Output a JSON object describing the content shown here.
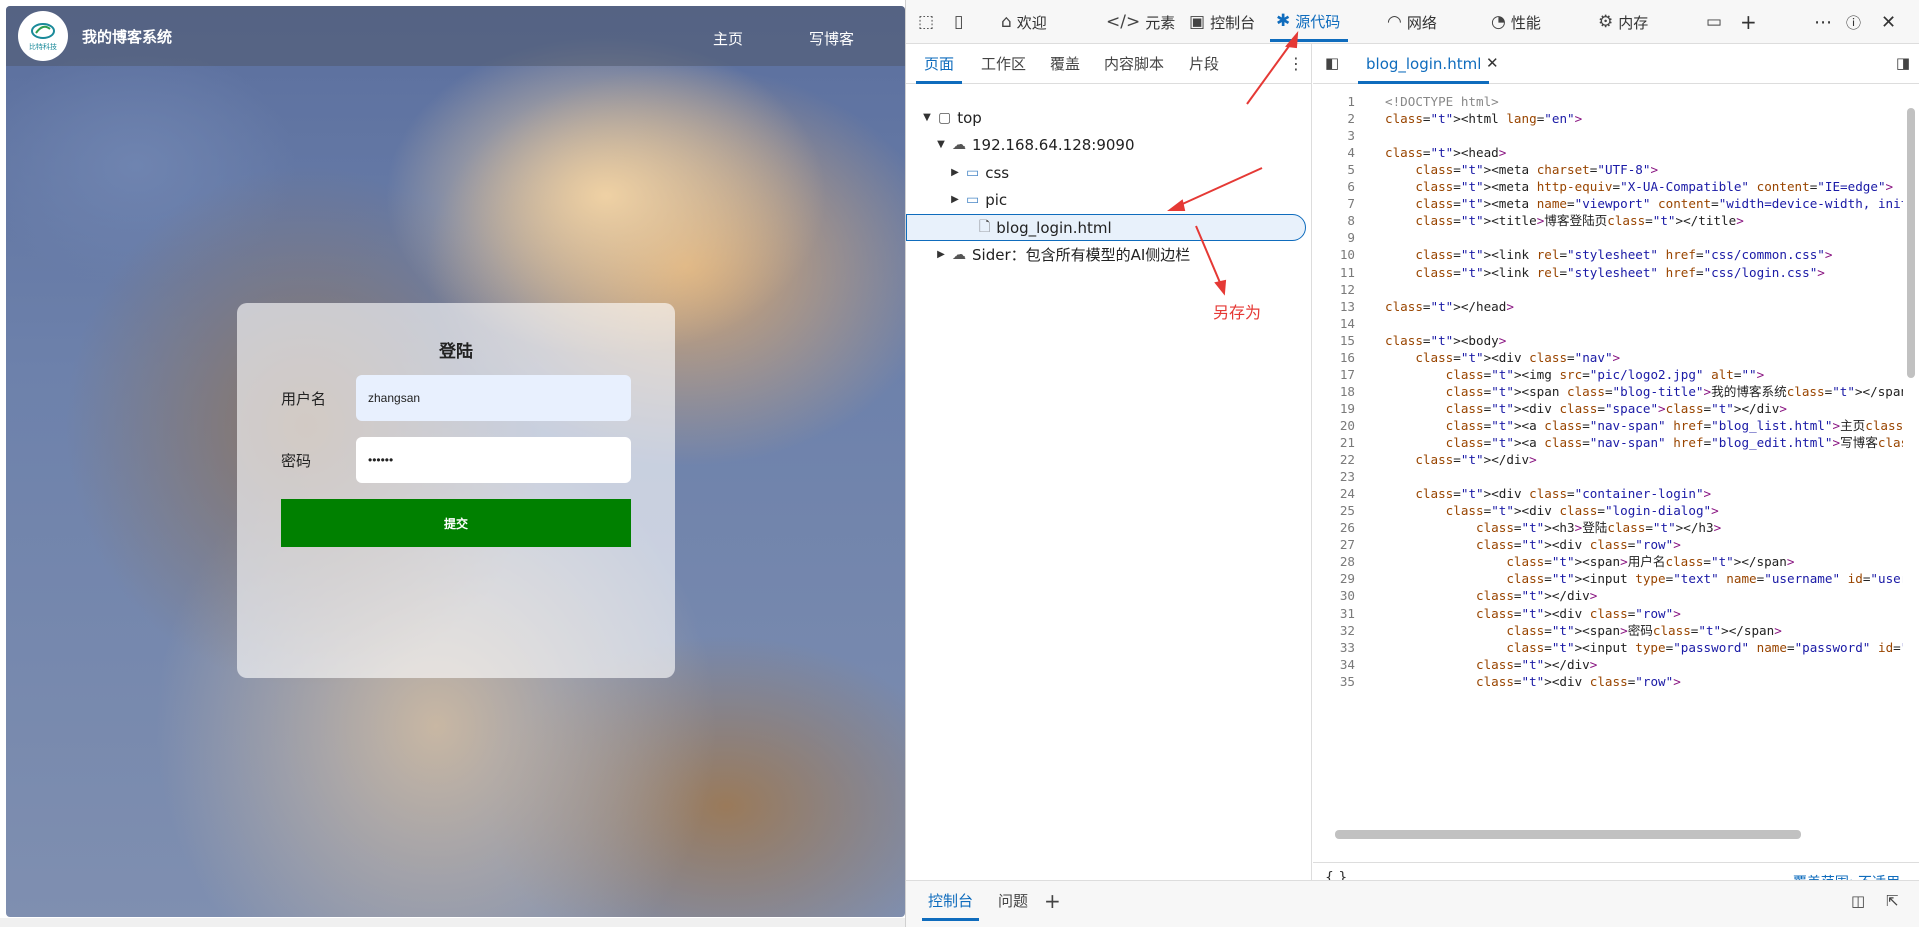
{
  "page": {
    "logo_text": "比特科技",
    "blog_title": "我的博客系统",
    "nav_links": [
      "主页",
      "写博客"
    ],
    "login": {
      "heading": "登陆",
      "username_label": "用户名",
      "username_value": "zhangsan",
      "password_label": "密码",
      "password_value": "••••••",
      "submit_label": "提交"
    }
  },
  "devtools": {
    "tabs": [
      "欢迎",
      "元素",
      "控制台",
      "源代码",
      "网络",
      "性能",
      "内存"
    ],
    "active_tab": "源代码",
    "navigator_tabs": [
      "页面",
      "工作区",
      "覆盖",
      "内容脚本",
      "片段"
    ],
    "tree": {
      "top": "top",
      "host": "192.168.64.128:9090",
      "folder_css": "css",
      "folder_pic": "pic",
      "file": "blog_login.html",
      "extension": "Sider：包含所有模型的AI侧边栏"
    },
    "editor_file": "blog_login.html",
    "status_braces": "{ }",
    "coverage": "覆盖范围: 不适用",
    "drawer_tabs": [
      "控制台",
      "问题"
    ],
    "annotation": "另存为",
    "accent_color": "#0f6cbd",
    "arrow_color": "#e53935"
  },
  "code_lines": [
    [
      "1",
      "<!DOCTYPE html>"
    ],
    [
      "2",
      "<html lang=\"en\">"
    ],
    [
      "3",
      ""
    ],
    [
      "4",
      "<head>"
    ],
    [
      "5",
      "    <meta charset=\"UTF-8\">"
    ],
    [
      "6",
      "    <meta http-equiv=\"X-UA-Compatible\" content=\"IE=edge\">"
    ],
    [
      "7",
      "    <meta name=\"viewport\" content=\"width=device-width, initial"
    ],
    [
      "8",
      "    <title>博客登陆页</title>"
    ],
    [
      "9",
      ""
    ],
    [
      "10",
      "    <link rel=\"stylesheet\" href=\"css/common.css\">"
    ],
    [
      "11",
      "    <link rel=\"stylesheet\" href=\"css/login.css\">"
    ],
    [
      "12",
      ""
    ],
    [
      "13",
      "</head>"
    ],
    [
      "14",
      ""
    ],
    [
      "15",
      "<body>"
    ],
    [
      "16",
      "    <div class=\"nav\">"
    ],
    [
      "17",
      "        <img src=\"pic/logo2.jpg\" alt=\"\">"
    ],
    [
      "18",
      "        <span class=\"blog-title\">我的博客系统</span>"
    ],
    [
      "19",
      "        <div class=\"space\"></div>"
    ],
    [
      "20",
      "        <a class=\"nav-span\" href=\"blog_list.html\">主页</a>"
    ],
    [
      "21",
      "        <a class=\"nav-span\" href=\"blog_edit.html\">写博客</a>"
    ],
    [
      "22",
      "    </div>"
    ],
    [
      "23",
      ""
    ],
    [
      "24",
      "    <div class=\"container-login\">"
    ],
    [
      "25",
      "        <div class=\"login-dialog\">"
    ],
    [
      "26",
      "            <h3>登陆</h3>"
    ],
    [
      "27",
      "            <div class=\"row\">"
    ],
    [
      "28",
      "                <span>用户名</span>"
    ],
    [
      "29",
      "                <input type=\"text\" name=\"username\" id=\"usernam"
    ],
    [
      "30",
      "            </div>"
    ],
    [
      "31",
      "            <div class=\"row\">"
    ],
    [
      "32",
      "                <span>密码</span>"
    ],
    [
      "33",
      "                <input type=\"password\" name=\"password\" id=\"pas"
    ],
    [
      "34",
      "            </div>"
    ],
    [
      "35",
      "            <div class=\"row\">"
    ]
  ]
}
